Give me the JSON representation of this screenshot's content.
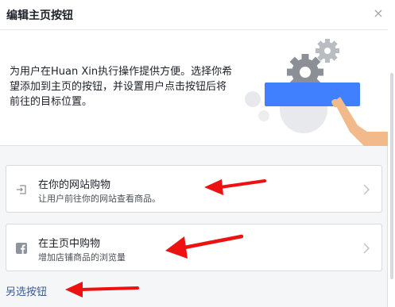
{
  "dialog": {
    "title": "编辑主页按钮",
    "close_glyph": "×"
  },
  "intro": {
    "text": "为用户在Huan Xin执行操作提供方便。选择你希望添加到主页的按钮，并设置用户点击按钮后将前往的目标位置。",
    "illustration": "gear-and-hand-pointer-illustration"
  },
  "options": [
    {
      "icon": "external-link-icon",
      "title": "在你的网站购物",
      "subtitle": "让用户前往你的网站查看商品。"
    },
    {
      "icon": "facebook-icon",
      "title": "在主页中购物",
      "subtitle": "增加店铺商品的浏览量"
    }
  ],
  "footer": {
    "more_link": "另选按钮"
  },
  "colors": {
    "accent_blue": "#4080ff",
    "link_blue": "#3b5998",
    "annotation_red": "#ee1111"
  }
}
